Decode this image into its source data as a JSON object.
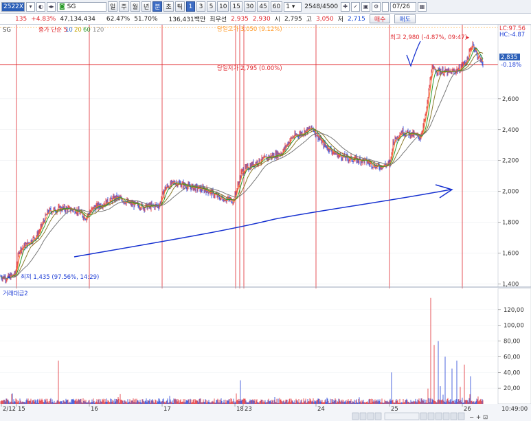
{
  "toolbar": {
    "code": "2522X",
    "stock_name": "SG",
    "periods": [
      "일",
      "주",
      "월",
      "년",
      "분",
      "초",
      "틱"
    ],
    "active_period": "분",
    "intervals": [
      "1",
      "3",
      "5",
      "10",
      "15",
      "30",
      "45",
      "60"
    ],
    "active_interval": "1",
    "count_select": "1",
    "count": "2548",
    "count_total": "/4500",
    "date": "07/26"
  },
  "quote": {
    "change": "135",
    "change_pct": "+4.83%",
    "volume": "47,134,434",
    "rate1": "62.47%",
    "rate2": "51.70%",
    "amount": "136,431백만",
    "best_label": "최우선",
    "best_ask": "2,935",
    "best_bid": "2,930",
    "open_label": "시",
    "open": "2,795",
    "high_label": "고",
    "high": "3,050",
    "low_label": "저",
    "low": "2,715",
    "buy_button": "매수",
    "sell_button": "매도"
  },
  "chart": {
    "legend_price": "종가 단순 5",
    "ma_legend": [
      "10",
      "20",
      "60",
      "120"
    ],
    "sg_label": "SG",
    "high_note": "당일고가 3,050 (9.12%)",
    "low_note": "당일저가 2,795 (0.00%)",
    "max_note": "최고 2,980 (-4.87%, 09:47)",
    "min_note": "최저 1,435 (97.56%, 14:29)",
    "lc_note": "LC:97.56",
    "hc_note": "HC:-4.87",
    "current_price": "2,835",
    "current_pct": "-0.18%",
    "volume_title": "거래대금2",
    "time": "10:49:00",
    "colors": {
      "up": "#e0282e",
      "down": "#1f3fd6",
      "ma5": "#ff7a2a",
      "ma10": "#2a9a2a",
      "ma20": "#8a7a2a",
      "ma60": "#777777",
      "arrow": "#1530d0"
    }
  },
  "chart_data": {
    "type": "line",
    "title": "",
    "xlabel": "",
    "ylabel": "",
    "x_ticks": [
      "2/12",
      "15",
      "16",
      "17",
      "18",
      "23",
      "24",
      "25",
      "26"
    ],
    "y_ticks": [
      "1,400",
      "1,600",
      "1,800",
      "2,000",
      "2,200",
      "2,400",
      "2,600"
    ],
    "ylim": [
      1380,
      3080
    ],
    "volume_ticks": [
      "20,00",
      "40,00",
      "60,00",
      "80,00",
      "100,00",
      "120,00"
    ],
    "volume_ylim": [
      0,
      140
    ],
    "series": [
      {
        "values_hint": "price path",
        "points": [
          [
            0,
            1450
          ],
          [
            10,
            1440
          ],
          [
            22,
            1460
          ],
          [
            28,
            1620
          ],
          [
            40,
            1660
          ],
          [
            55,
            1720
          ],
          [
            70,
            1870
          ],
          [
            90,
            1890
          ],
          [
            110,
            1880
          ],
          [
            125,
            1830
          ],
          [
            135,
            1890
          ],
          [
            150,
            1920
          ],
          [
            170,
            1960
          ],
          [
            190,
            1920
          ],
          [
            210,
            1900
          ],
          [
            232,
            1910
          ],
          [
            240,
            2020
          ],
          [
            255,
            2060
          ],
          [
            275,
            2030
          ],
          [
            300,
            2010
          ],
          [
            320,
            1960
          ],
          [
            340,
            1940
          ],
          [
            352,
            2130
          ],
          [
            370,
            2180
          ],
          [
            390,
            2220
          ],
          [
            410,
            2250
          ],
          [
            425,
            2350
          ],
          [
            440,
            2380
          ],
          [
            455,
            2410
          ],
          [
            470,
            2310
          ],
          [
            490,
            2240
          ],
          [
            510,
            2210
          ],
          [
            530,
            2200
          ],
          [
            550,
            2160
          ],
          [
            568,
            2180
          ],
          [
            572,
            2320
          ],
          [
            585,
            2390
          ],
          [
            600,
            2370
          ],
          [
            612,
            2350
          ],
          [
            620,
            2500
          ],
          [
            628,
            2790
          ],
          [
            640,
            2780
          ],
          [
            655,
            2770
          ],
          [
            668,
            2790
          ],
          [
            680,
            2850
          ],
          [
            688,
            2960
          ],
          [
            695,
            2880
          ],
          [
            703,
            2830
          ]
        ]
      }
    ]
  }
}
